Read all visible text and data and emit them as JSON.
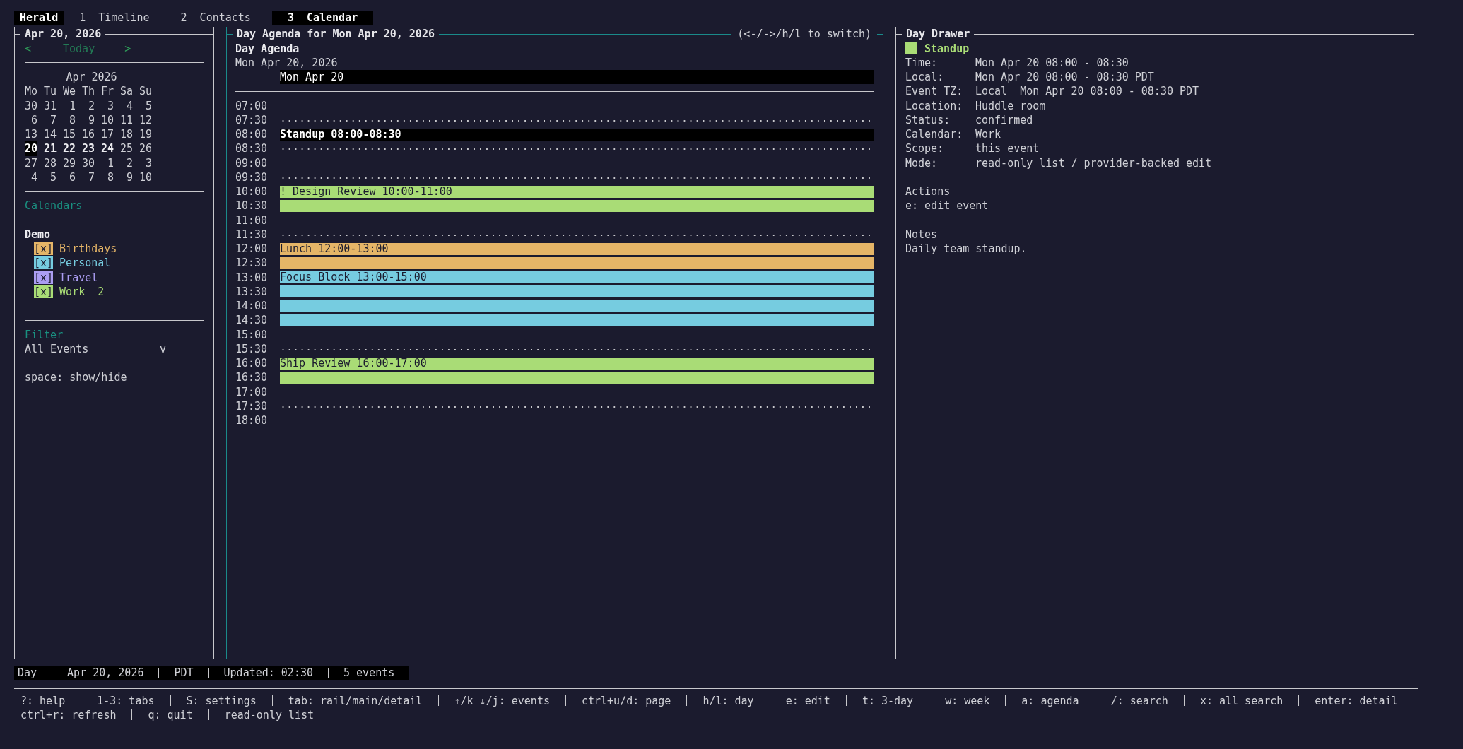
{
  "app_name": "Herald",
  "tabs": [
    {
      "key": "1",
      "label": "Timeline",
      "selected": false
    },
    {
      "key": "2",
      "label": "Contacts",
      "selected": false
    },
    {
      "key": "3",
      "label": "Calendar",
      "selected": true
    }
  ],
  "rail": {
    "title": "Apr 20, 2026",
    "prev": "<",
    "today": "Today",
    "next": ">",
    "month": "Apr 2026",
    "weekdays": [
      "Mo",
      "Tu",
      "We",
      "Th",
      "Fr",
      "Sa",
      "Su"
    ],
    "weeks": [
      [
        {
          "day": "30",
          "bold": false,
          "selected": false
        },
        {
          "day": "31",
          "bold": false,
          "selected": false
        },
        {
          "day": "1",
          "bold": false,
          "selected": false
        },
        {
          "day": "2",
          "bold": false,
          "selected": false
        },
        {
          "day": "3",
          "bold": false,
          "selected": false
        },
        {
          "day": "4",
          "bold": false,
          "selected": false
        },
        {
          "day": "5",
          "bold": false,
          "selected": false
        }
      ],
      [
        {
          "day": "6",
          "bold": false,
          "selected": false
        },
        {
          "day": "7",
          "bold": false,
          "selected": false
        },
        {
          "day": "8",
          "bold": false,
          "selected": false
        },
        {
          "day": "9",
          "bold": false,
          "selected": false
        },
        {
          "day": "10",
          "bold": false,
          "selected": false
        },
        {
          "day": "11",
          "bold": false,
          "selected": false
        },
        {
          "day": "12",
          "bold": false,
          "selected": false
        }
      ],
      [
        {
          "day": "13",
          "bold": false,
          "selected": false
        },
        {
          "day": "14",
          "bold": false,
          "selected": false
        },
        {
          "day": "15",
          "bold": false,
          "selected": false
        },
        {
          "day": "16",
          "bold": false,
          "selected": false
        },
        {
          "day": "17",
          "bold": false,
          "selected": false
        },
        {
          "day": "18",
          "bold": false,
          "selected": false
        },
        {
          "day": "19",
          "bold": false,
          "selected": false
        }
      ],
      [
        {
          "day": "20",
          "bold": true,
          "selected": true
        },
        {
          "day": "21",
          "bold": true,
          "selected": false
        },
        {
          "day": "22",
          "bold": true,
          "selected": false
        },
        {
          "day": "23",
          "bold": true,
          "selected": false
        },
        {
          "day": "24",
          "bold": true,
          "selected": false
        },
        {
          "day": "25",
          "bold": false,
          "selected": false
        },
        {
          "day": "26",
          "bold": false,
          "selected": false
        }
      ],
      [
        {
          "day": "27",
          "bold": false,
          "selected": false
        },
        {
          "day": "28",
          "bold": false,
          "selected": false
        },
        {
          "day": "29",
          "bold": false,
          "selected": false
        },
        {
          "day": "30",
          "bold": false,
          "selected": false
        },
        {
          "day": "1",
          "bold": false,
          "selected": false
        },
        {
          "day": "2",
          "bold": false,
          "selected": false
        },
        {
          "day": "3",
          "bold": false,
          "selected": false
        }
      ],
      [
        {
          "day": "4",
          "bold": false,
          "selected": false
        },
        {
          "day": "5",
          "bold": false,
          "selected": false
        },
        {
          "day": "6",
          "bold": false,
          "selected": false
        },
        {
          "day": "7",
          "bold": false,
          "selected": false
        },
        {
          "day": "8",
          "bold": false,
          "selected": false
        },
        {
          "day": "9",
          "bold": false,
          "selected": false
        },
        {
          "day": "10",
          "bold": false,
          "selected": false
        }
      ]
    ],
    "calendars_heading": "Calendars",
    "group": "Demo",
    "calendars": [
      {
        "box": "[x]",
        "name": "Birthdays",
        "color": "#e5b567",
        "checked": true
      },
      {
        "box": "[x]",
        "name": "Personal",
        "color": "#76cce0",
        "checked": true
      },
      {
        "box": "[x]",
        "name": "Travel",
        "color": "#ab9df2",
        "checked": true
      },
      {
        "box": "[x]",
        "name": "Work",
        "count": "2",
        "color": "#a9dc76",
        "checked": true
      }
    ],
    "filter_heading": "Filter",
    "filter": {
      "value": "All Events",
      "caret": "v"
    },
    "hint": "space: show/hide"
  },
  "main": {
    "title": "Day Agenda for Mon Apr 20, 2026",
    "switch_hint": "(<-/->/h/l to switch)",
    "heading": "Day Agenda",
    "date": "Mon Apr 20, 2026",
    "column_header": "Mon Apr 20",
    "slots": [
      {
        "time": "07:00",
        "kind": "empty"
      },
      {
        "time": "07:30",
        "kind": "dotted"
      },
      {
        "time": "08:00",
        "kind": "event",
        "label": "Standup 08:00-08:30",
        "selected": true
      },
      {
        "time": "08:30",
        "kind": "dotted"
      },
      {
        "time": "09:00",
        "kind": "empty"
      },
      {
        "time": "09:30",
        "kind": "dotted"
      },
      {
        "time": "10:00",
        "kind": "event",
        "label": "! Design Review 10:00-11:00",
        "color": "#a9dc76",
        "selected": false
      },
      {
        "time": "10:30",
        "kind": "continuation",
        "color": "#a9dc76"
      },
      {
        "time": "11:00",
        "kind": "empty"
      },
      {
        "time": "11:30",
        "kind": "dotted"
      },
      {
        "time": "12:00",
        "kind": "event",
        "label": "Lunch 12:00-13:00",
        "color": "#e5b567",
        "selected": false
      },
      {
        "time": "12:30",
        "kind": "continuation",
        "color": "#e5b567"
      },
      {
        "time": "13:00",
        "kind": "event",
        "label": "Focus Block 13:00-15:00",
        "color": "#76cce0",
        "selected": false
      },
      {
        "time": "13:30",
        "kind": "continuation",
        "color": "#76cce0"
      },
      {
        "time": "14:00",
        "kind": "continuation",
        "color": "#76cce0"
      },
      {
        "time": "14:30",
        "kind": "continuation",
        "color": "#76cce0"
      },
      {
        "time": "15:00",
        "kind": "empty"
      },
      {
        "time": "15:30",
        "kind": "dotted"
      },
      {
        "time": "16:00",
        "kind": "event",
        "label": "Ship Review 16:00-17:00",
        "color": "#a9dc76",
        "selected": false
      },
      {
        "time": "16:30",
        "kind": "continuation",
        "color": "#a9dc76"
      },
      {
        "time": "17:00",
        "kind": "empty"
      },
      {
        "time": "17:30",
        "kind": "dotted"
      },
      {
        "time": "18:00",
        "kind": "empty"
      }
    ]
  },
  "drawer": {
    "title": "Day Drawer",
    "event": {
      "name": "Standup",
      "color": "#a9dc76"
    },
    "fields": [
      {
        "label": "Time:",
        "value": "Mon Apr 20 08:00 - 08:30"
      },
      {
        "label": "Local:",
        "value": "Mon Apr 20 08:00 - 08:30 PDT"
      },
      {
        "label": "Event TZ:",
        "value": "Local  Mon Apr 20 08:00 - 08:30 PDT"
      },
      {
        "label": "Location:",
        "value": "Huddle room"
      },
      {
        "label": "Status:",
        "value": "confirmed"
      },
      {
        "label": "Calendar:",
        "value": "Work"
      },
      {
        "label": "Scope:",
        "value": "this event"
      },
      {
        "label": "Mode:",
        "value": "read-only list / provider-backed edit"
      }
    ],
    "actions_heading": "Actions",
    "actions": [
      "e: edit event"
    ],
    "notes_heading": "Notes",
    "notes": "Daily team standup."
  },
  "status_bar": [
    "Day",
    "Apr 20, 2026",
    "PDT",
    "Updated: 02:30",
    "5 events"
  ],
  "help_lines": [
    [
      "?: help",
      "1-3: tabs",
      "S: settings",
      "tab: rail/main/detail",
      "↑/k ↓/j: events",
      "ctrl+u/d: page",
      "h/l: day",
      "e: edit",
      "t: 3-day",
      "w: week",
      "a: agenda",
      "/: search",
      "x: all search",
      "enter: detail"
    ],
    [
      "ctrl+r: refresh",
      "q: quit",
      "read-only list"
    ]
  ]
}
